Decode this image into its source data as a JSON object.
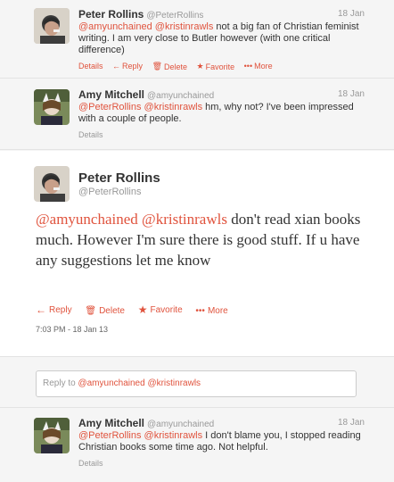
{
  "tweets": [
    {
      "name": "Peter Rollins",
      "handle": "@PeterRollins",
      "date": "18 Jan",
      "mentions": "@amyunchained @kristinrawls",
      "body": " not a big fan of Christian feminist writing. I am very close to Butler however (with one critical difference)",
      "actions": {
        "details": "Details",
        "reply": "Reply",
        "delete": "Delete",
        "favorite": "Favorite",
        "more": "More"
      }
    },
    {
      "name": "Amy Mitchell",
      "handle": "@amyunchained",
      "date": "18 Jan",
      "mentions": "@PeterRollins @kristinrawls",
      "body": " hm, why not? I've been impressed with a couple of people.",
      "details": "Details"
    },
    {
      "name": "Amy Mitchell",
      "handle": "@amyunchained",
      "date": "18 Jan",
      "mentions": "@PeterRollins @kristinrawls",
      "body": " I don't blame you, I stopped reading Christian books some time ago. Not helpful.",
      "details": "Details"
    }
  ],
  "main": {
    "name": "Peter Rollins",
    "handle": "@PeterRollins",
    "mentions": "@amyunchained @kristinrawls",
    "body": " don't read xian books much. However I'm sure there is good stuff. If u have any suggestions let me know",
    "actions": {
      "reply": "Reply",
      "delete": "Delete",
      "favorite": "Favorite",
      "more": "More"
    },
    "timestamp": "7:03 PM - 18 Jan 13"
  },
  "reply": {
    "placeholder_prefix": "Reply to ",
    "placeholder_mentions": "@amyunchained @kristinrawls"
  },
  "colors": {
    "accent": "#e0533d",
    "muted": "#999999",
    "text": "#333333"
  }
}
